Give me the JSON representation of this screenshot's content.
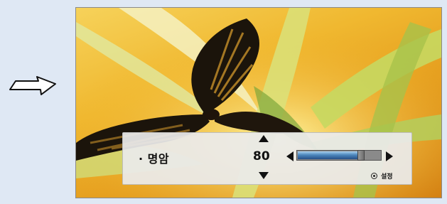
{
  "osd": {
    "label": "· 명암",
    "value": "80",
    "level_percent": 80,
    "hint": "설정"
  },
  "icons": {
    "transition": "right-outline-arrow-icon",
    "up": "triangle-up-icon",
    "down": "triangle-down-icon",
    "left": "triangle-left-icon",
    "right": "triangle-right-icon",
    "enter": "enter-circle-icon"
  },
  "colors": {
    "page_background": "#dfe8f4",
    "slider_fill": "#4c87bd",
    "panel_background": "#ebebeb"
  }
}
